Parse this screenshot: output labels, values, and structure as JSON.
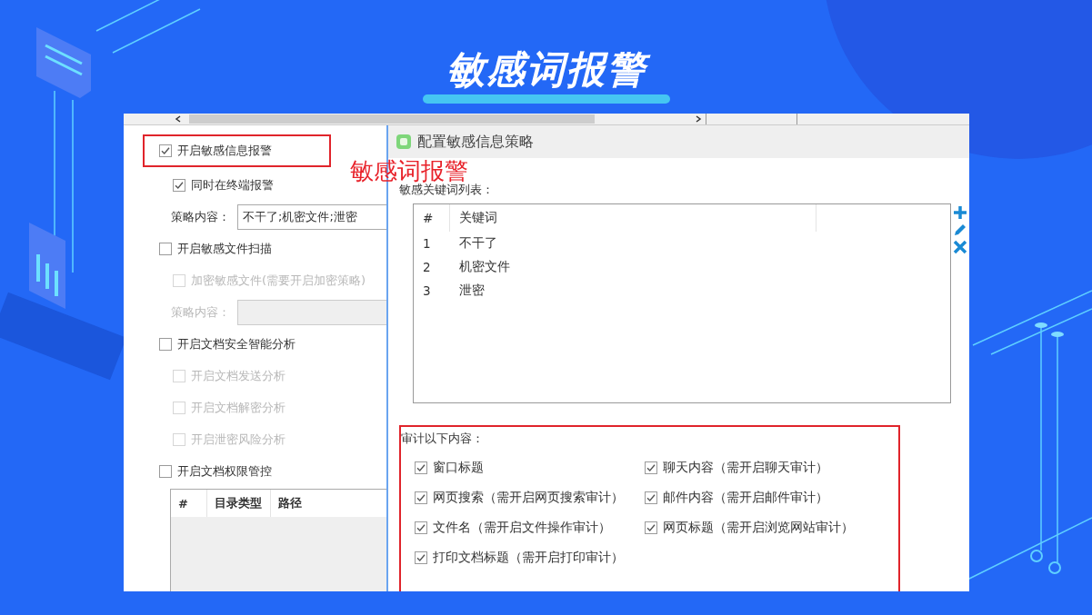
{
  "slide": {
    "title": "敏感词报警",
    "annotation": "敏感词报警"
  },
  "settings": [
    {
      "kind": "checkbox",
      "label": "开启敏感信息报警",
      "checked": true,
      "highlighted": true,
      "children": [
        {
          "kind": "checkbox",
          "label": "同时在终端报警",
          "checked": true,
          "disabled": false
        },
        {
          "kind": "field",
          "label": "策略内容：",
          "value": "不干了;机密文件;泄密",
          "disabled": false
        }
      ]
    },
    {
      "kind": "checkbox",
      "label": "开启敏感文件扫描",
      "checked": false,
      "children": [
        {
          "kind": "checkbox",
          "label": "加密敏感文件(需要开启加密策略)",
          "checked": false,
          "disabled": true
        },
        {
          "kind": "field",
          "label": "策略内容：",
          "disabled": true
        }
      ]
    },
    {
      "kind": "checkbox",
      "label": "开启文档安全智能分析",
      "checked": false,
      "children": [
        {
          "kind": "checkbox",
          "label": "开启文档发送分析",
          "checked": false,
          "disabled": true
        },
        {
          "kind": "checkbox",
          "label": "开启文档解密分析",
          "checked": false,
          "disabled": true
        },
        {
          "kind": "checkbox",
          "label": "开启泄密风险分析",
          "checked": false,
          "disabled": true
        }
      ]
    },
    {
      "kind": "checkbox",
      "label": "开启文档权限管控",
      "checked": false,
      "children": [
        {
          "kind": "table",
          "columns": [
            "#",
            "目录类型",
            "路径"
          ]
        }
      ]
    }
  ],
  "dialog": {
    "title": "配置敏感信息策略",
    "list_label": "敏感关键词列表：",
    "columns": [
      "#",
      "关键词"
    ],
    "rows": [
      {
        "index": "1",
        "keyword": "不干了"
      },
      {
        "index": "2",
        "keyword": "机密文件"
      },
      {
        "index": "3",
        "keyword": "泄密"
      }
    ],
    "audit": {
      "label": "审计以下内容：",
      "highlighted": true,
      "options": [
        {
          "label": "窗口标题",
          "checked": true
        },
        {
          "label": "聊天内容（需开启聊天审计）",
          "checked": true
        },
        {
          "label": "网页搜索（需开启网页搜索审计）",
          "checked": true
        },
        {
          "label": "邮件内容（需开启邮件审计）",
          "checked": true
        },
        {
          "label": "文件名（需开启文件操作审计）",
          "checked": true
        },
        {
          "label": "网页标题（需开启浏览网站审计）",
          "checked": true
        },
        {
          "label": "打印文档标题（需开启打印审计）",
          "checked": true
        }
      ]
    }
  }
}
